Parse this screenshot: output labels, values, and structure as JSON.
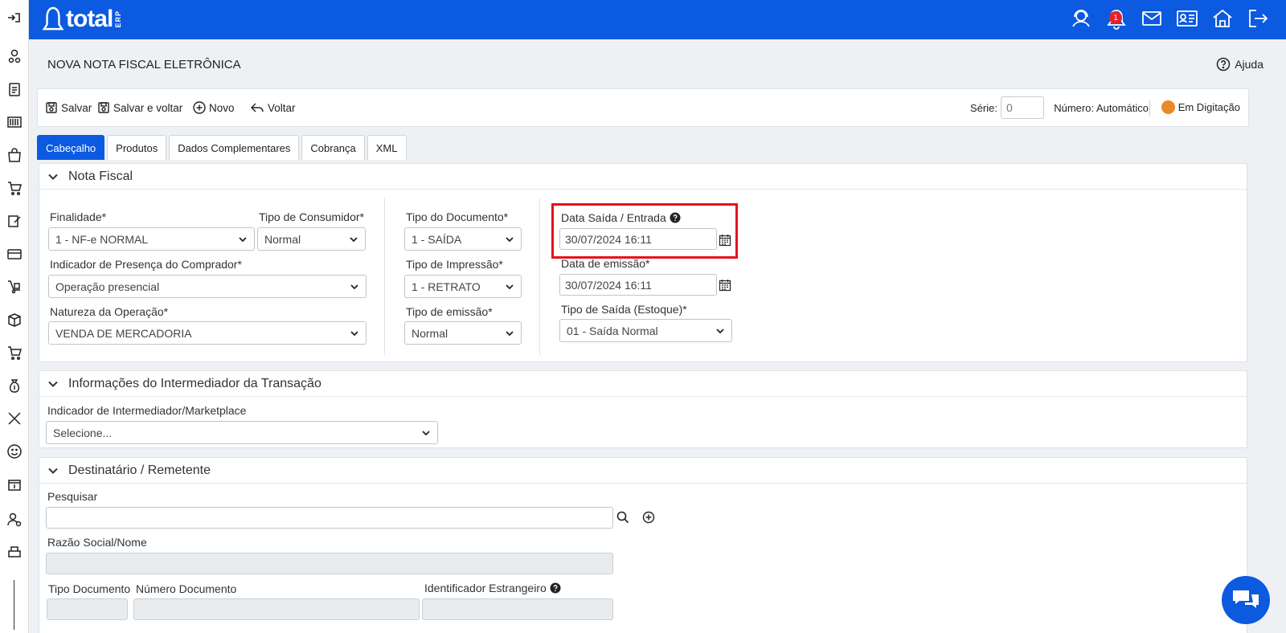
{
  "brand": {
    "name": "total",
    "suffix": "ERP"
  },
  "topbar": {
    "notification_count": "1"
  },
  "page": {
    "title": "NOVA NOTA FISCAL ELETRÔNICA",
    "help_label": "Ajuda"
  },
  "toolbar": {
    "save_label": "Salvar",
    "save_back_label": "Salvar e voltar",
    "new_label": "Novo",
    "back_label": "Voltar",
    "serie_label": "Série:",
    "serie_value": "0",
    "numero_label": "Número: Automático",
    "status_label": "Em Digitação",
    "status_color": "#ea8a26"
  },
  "tabs": [
    {
      "label": "Cabeçalho",
      "active": true
    },
    {
      "label": "Produtos"
    },
    {
      "label": "Dados Complementares"
    },
    {
      "label": "Cobrança"
    },
    {
      "label": "XML"
    }
  ],
  "nota_fiscal": {
    "title": "Nota Fiscal",
    "finalidade_label": "Finalidade*",
    "finalidade_value": "1 - NF-e NORMAL",
    "tipo_consumidor_label": "Tipo de Consumidor*",
    "tipo_consumidor_value": "Normal",
    "presenca_label": "Indicador de Presença do Comprador*",
    "presenca_value": "Operação presencial",
    "natureza_label": "Natureza da Operação*",
    "natureza_value": "VENDA DE MERCADORIA",
    "tipo_documento_label": "Tipo do Documento*",
    "tipo_documento_value": "1 - SAÍDA",
    "tipo_impressao_label": "Tipo de Impressão*",
    "tipo_impressao_value": "1 - RETRATO",
    "tipo_emissao_label": "Tipo de emissão*",
    "tipo_emissao_value": "Normal",
    "data_saida_label": "Data Saída / Entrada",
    "data_saida_value": "30/07/2024 16:11",
    "data_emissao_label": "Data de emissão*",
    "data_emissao_value": "30/07/2024 16:11",
    "tipo_saida_label": "Tipo de Saída (Estoque)*",
    "tipo_saida_value": "01 - Saída Normal"
  },
  "intermediador": {
    "title": "Informações do Intermediador da Transação",
    "indicador_label": "Indicador de Intermediador/Marketplace",
    "indicador_value": "Selecione..."
  },
  "destinatario": {
    "title": "Destinatário / Remetente",
    "pesquisar_label": "Pesquisar",
    "razao_label": "Razão Social/Nome",
    "tipo_doc_label": "Tipo Documento",
    "numero_doc_label": "Número Documento",
    "estrangeiro_label": "Identificador Estrangeiro"
  },
  "colors": {
    "primary": "#0b5ae0",
    "highlight": "#e8101c"
  }
}
